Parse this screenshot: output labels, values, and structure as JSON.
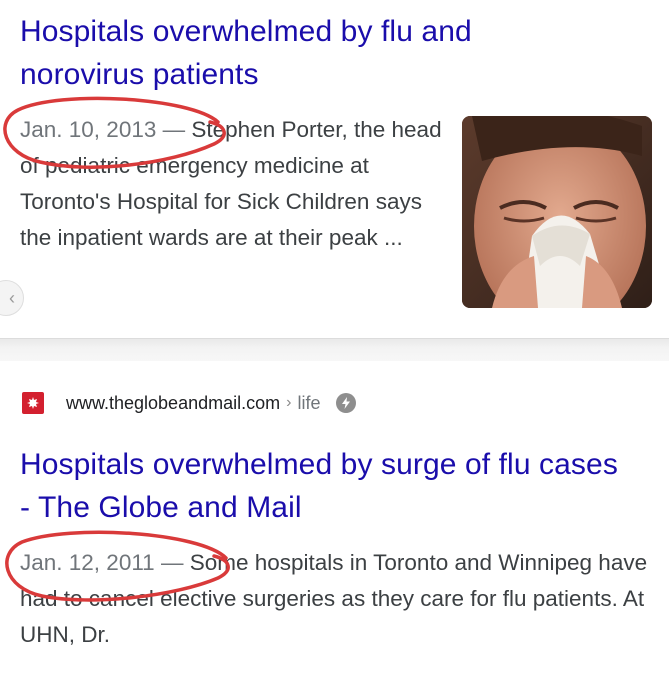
{
  "results": [
    {
      "title": "Hospitals overwhelmed by flu and norovirus patients",
      "date": "Jan. 10, 2013",
      "separator": " — ",
      "snippet": "Stephen Porter, the head of pediatric emergency medicine at Toronto's Hospital for Sick Children says the inpatient wards are at their peak ...",
      "thumbnail_icon": "person-sneezing-into-tissue-image"
    },
    {
      "source_url": "www.theglobeandmail.com",
      "source_crumb": "life",
      "title": "Hospitals overwhelmed by surge of flu cases - The Globe and Mail",
      "date": "Jan. 12, 2011",
      "separator": " — ",
      "snippet": "Some hospitals in Toronto and Winnipeg have had to cancel elective surgeries as they care for flu patients. At UHN, Dr."
    }
  ],
  "colors": {
    "title_link": "#1a0dab",
    "snippet_text": "#3c4043",
    "favicon_bg": "#d3202f",
    "highlight_circle": "#d93a3a"
  }
}
